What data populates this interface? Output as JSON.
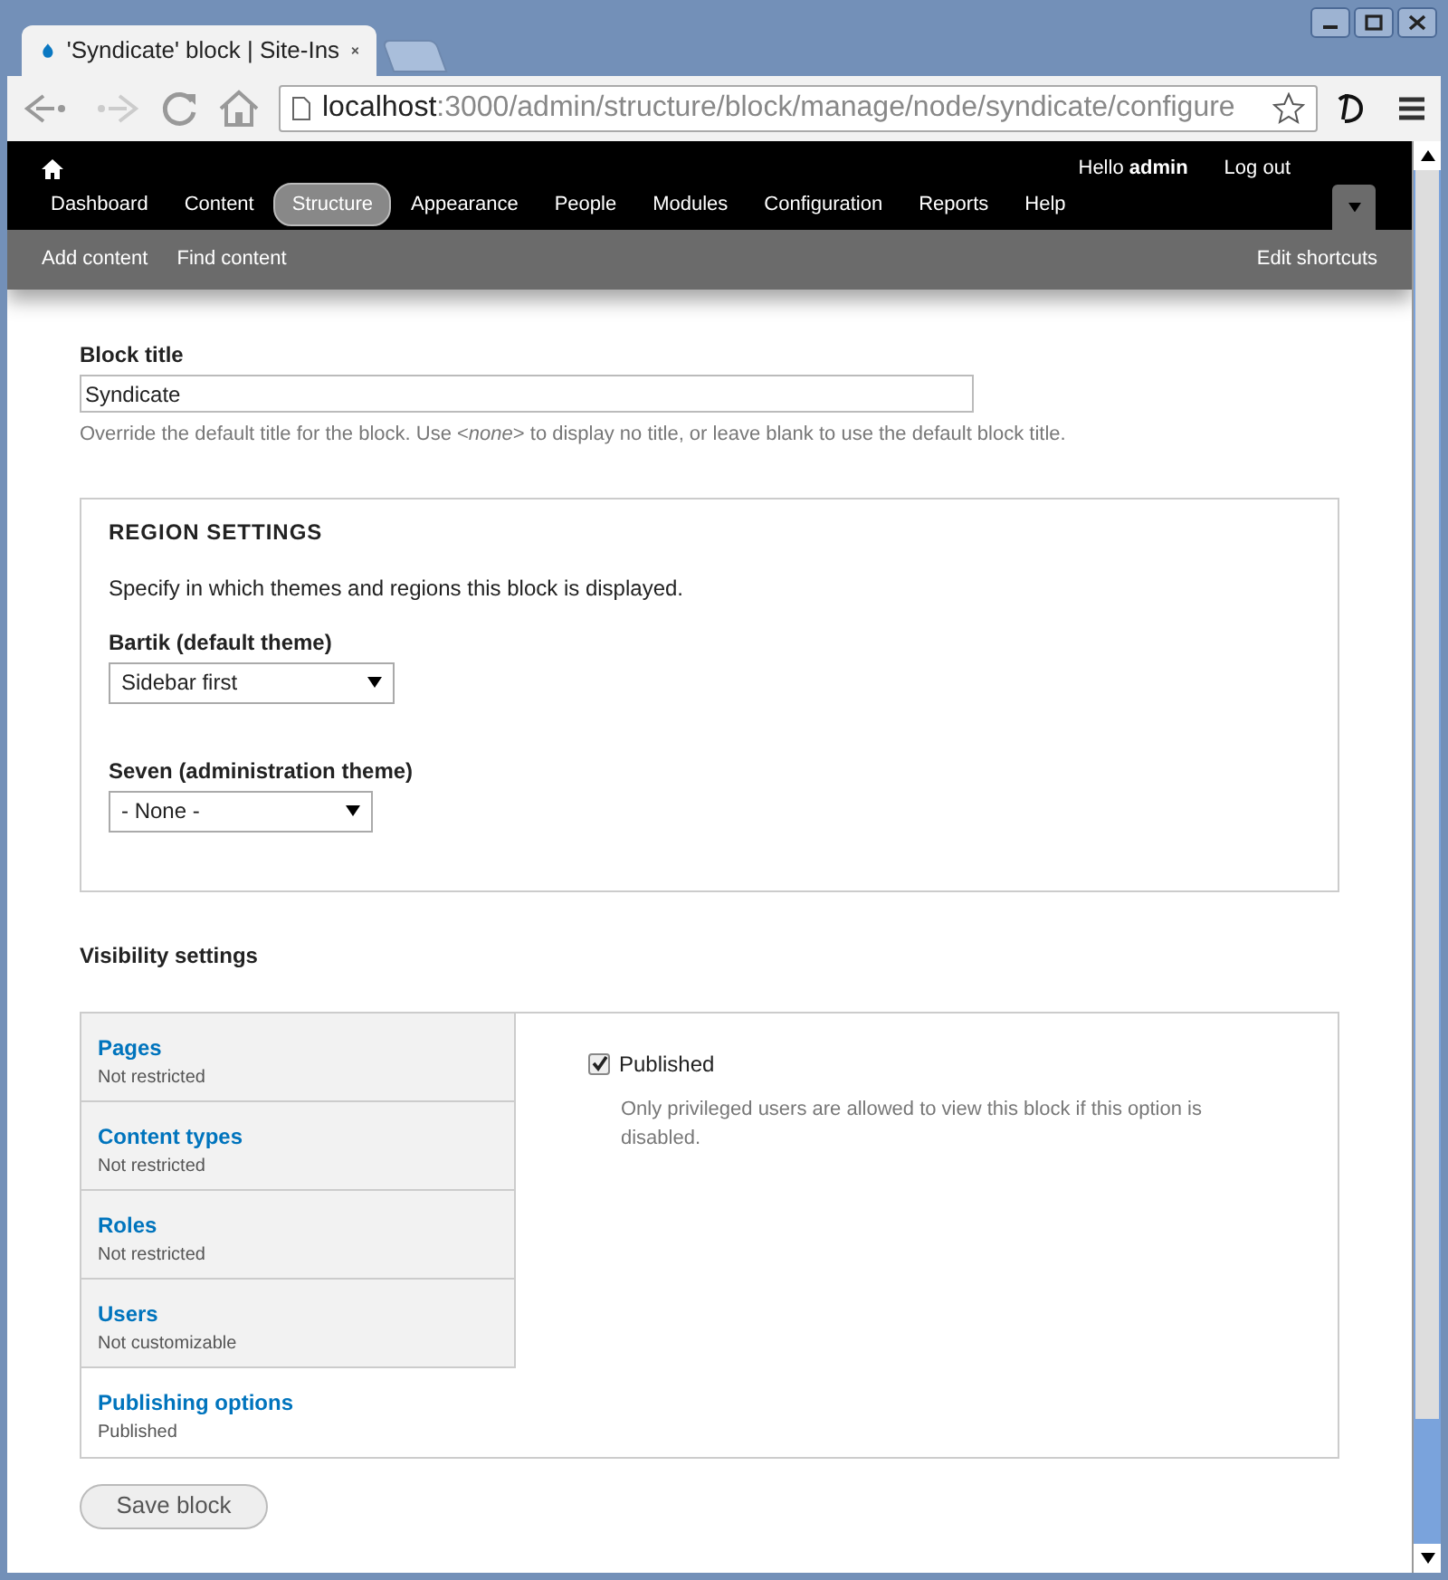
{
  "browser": {
    "tab_title": "'Syndicate' block | Site-Ins",
    "url_host": "localhost",
    "url_rest": ":3000/admin/structure/block/manage/node/syndicate/configure"
  },
  "toolbar": {
    "greeting": "Hello",
    "user": "admin",
    "logout": "Log out",
    "menu": [
      {
        "label": "Dashboard",
        "selected": false
      },
      {
        "label": "Content",
        "selected": false
      },
      {
        "label": "Structure",
        "selected": true
      },
      {
        "label": "Appearance",
        "selected": false
      },
      {
        "label": "People",
        "selected": false
      },
      {
        "label": "Modules",
        "selected": false
      },
      {
        "label": "Configuration",
        "selected": false
      },
      {
        "label": "Reports",
        "selected": false
      },
      {
        "label": "Help",
        "selected": false
      }
    ],
    "shortcuts": [
      "Add content",
      "Find content"
    ],
    "edit_shortcuts": "Edit shortcuts"
  },
  "block_title": {
    "label": "Block title",
    "value": "Syndicate",
    "description": "Override the default title for the block. Use <*none*> to display no title, or leave blank to use the default block title."
  },
  "region_settings": {
    "legend": "REGION SETTINGS",
    "description": "Specify in which themes and regions this block is displayed.",
    "themes": [
      {
        "label": "Bartik (default theme)",
        "value": "Sidebar first"
      },
      {
        "label": "Seven (administration theme)",
        "value": "- None -"
      }
    ]
  },
  "visibility": {
    "title": "Visibility settings",
    "tabs": [
      {
        "title": "Pages",
        "summary": "Not restricted",
        "selected": false
      },
      {
        "title": "Content types",
        "summary": "Not restricted",
        "selected": false
      },
      {
        "title": "Roles",
        "summary": "Not restricted",
        "selected": false
      },
      {
        "title": "Users",
        "summary": "Not customizable",
        "selected": false
      },
      {
        "title": "Publishing options",
        "summary": "Published",
        "selected": true
      }
    ],
    "pane": {
      "checkbox": {
        "label": "Published",
        "checked": true
      },
      "description": "Only privileged users are allowed to view this block if this option is disabled."
    }
  },
  "save_button": "Save block"
}
